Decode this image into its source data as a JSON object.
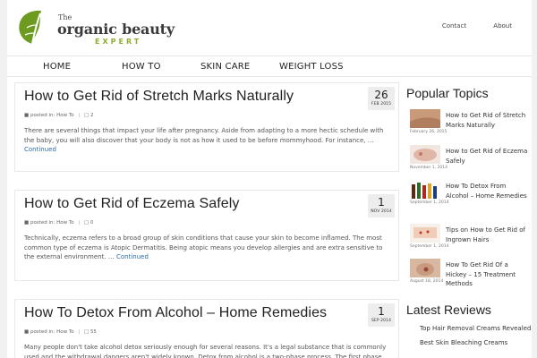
{
  "header": {
    "logo_line1": "The",
    "logo_line2": "organic beauty",
    "logo_line3": "EXPERT",
    "links": [
      "Contact",
      "About"
    ]
  },
  "nav": {
    "items": [
      "HOME",
      "HOW TO",
      "SKIN CARE",
      "WEIGHT LOSS"
    ]
  },
  "posts": [
    {
      "title": "How to Get Rid of Stretch Marks Naturally",
      "posted_in_label": "posted in:",
      "category": "How To",
      "comments": "2",
      "day": "26",
      "month": "FEB 2015",
      "excerpt": "There are several things that impact your life after pregnancy. Aside from adapting to a more hectic schedule with the baby, you will also discover that your body is not as how it used to be before mommyhood. For instance, …",
      "continue": "Continued"
    },
    {
      "title": "How to Get Rid of Eczema Safely",
      "posted_in_label": "posted in:",
      "category": "How To",
      "comments": "0",
      "day": "1",
      "month": "NOV 2014",
      "excerpt": "Technically, eczema refers to a broad group of skin conditions that cause your skin to become inflamed. The most common type of eczema is Atopic Dermatitis. Being atopic means you develop allergies and are extra sensitive to the external environment. …",
      "continue": "Continued"
    },
    {
      "title": "How To Detox From Alcohol – Home Remedies",
      "posted_in_label": "posted in:",
      "category": "How To",
      "comments": "55",
      "day": "1",
      "month": "SEP 2014",
      "excerpt": "Many people don't take alcohol detox seriously enough for several reasons. It's a legal substance that is commonly used and the withdrawal dangers aren't widely known. Detox from alcohol is a two-phase process. The first phase",
      "continue": ""
    }
  ],
  "sidebar": {
    "popular_heading": "Popular Topics",
    "popular": [
      {
        "title": "How to Get Rid of Stretch Marks Naturally",
        "date": "February 26, 2015"
      },
      {
        "title": "How to Get Rid of Eczema Safely",
        "date": "November 1, 2014"
      },
      {
        "title": "How To Detox From Alcohol – Home Remedies",
        "date": "September 1, 2014"
      },
      {
        "title": "Tips on How to Get Rid of Ingrown Hairs",
        "date": "September 1, 2014"
      },
      {
        "title": "How To Get Rid Of a Hickey – 15 Treatment Methods",
        "date": "August 18, 2014"
      }
    ],
    "reviews_heading": "Latest Reviews",
    "reviews": [
      "Top Hair Removal Creams Revealed",
      "Best Skin Bleaching Creams"
    ]
  },
  "colors": {
    "accent_green": "#8dae2c",
    "link_blue": "#2a6ab0",
    "datebox_bg": "#ededed"
  }
}
